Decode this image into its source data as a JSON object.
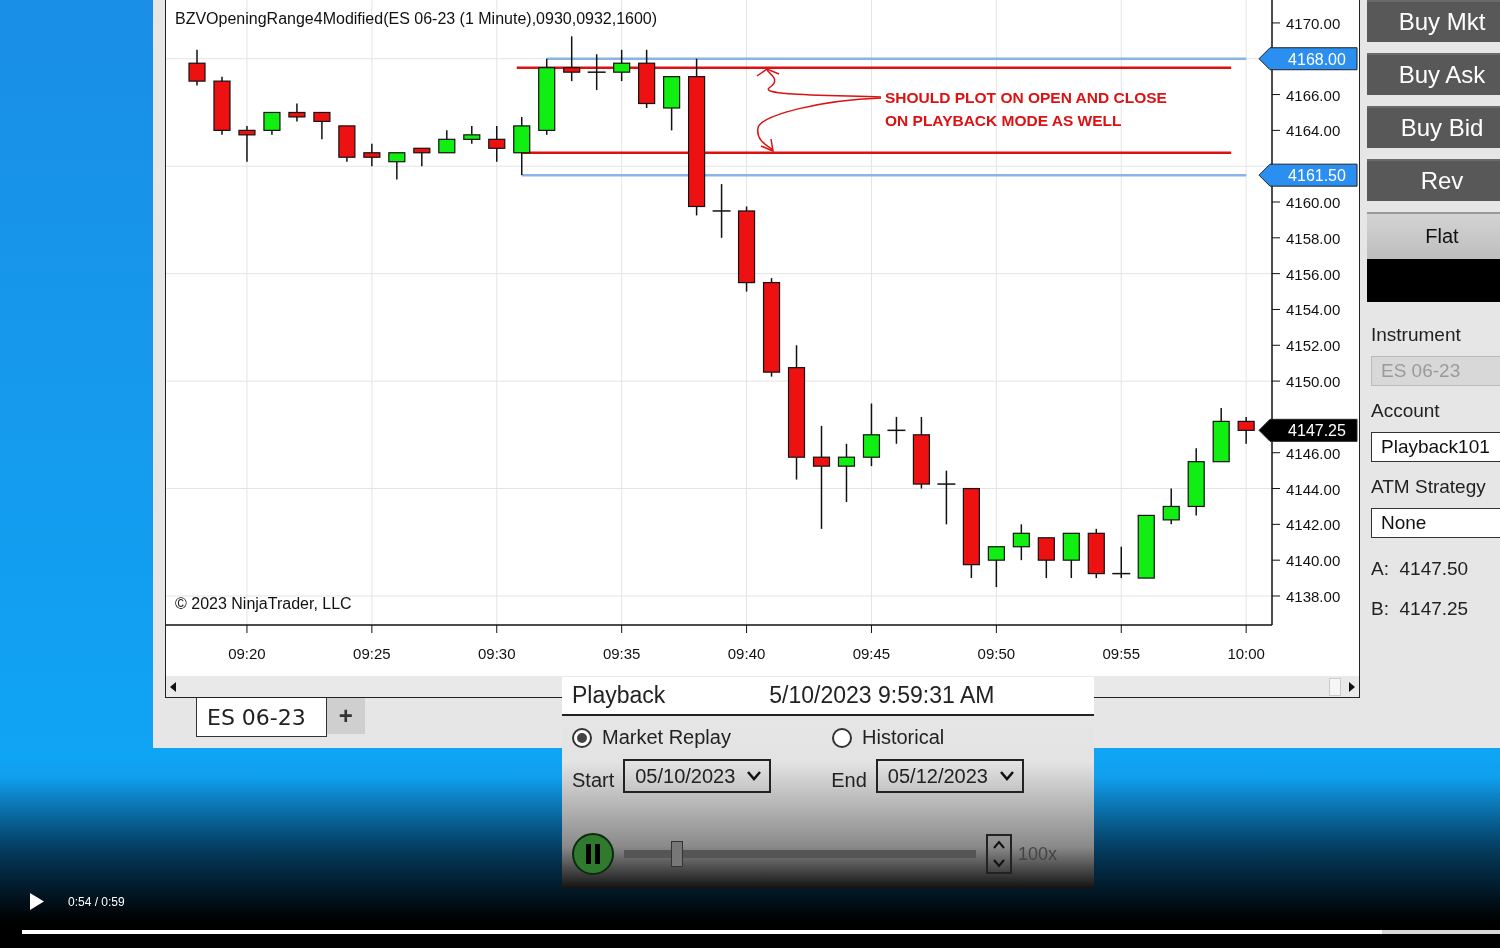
{
  "chart": {
    "title": "BZVOpeningRange4Modified(ES 06-23 (1 Minute),0930,0932,1600)",
    "copyright": "© 2023 NinjaTrader, LLC",
    "chart_data": {
      "type": "candlestick",
      "ylim": [
        4136.38,
        4171.28
      ],
      "grid": true,
      "categories": [
        null,
        null,
        "09:20",
        null,
        null,
        null,
        null,
        "09:25",
        null,
        null,
        null,
        null,
        "09:30",
        null,
        null,
        null,
        null,
        "09:35",
        null,
        null,
        null,
        null,
        "09:40",
        null,
        null,
        null,
        null,
        "09:45",
        null,
        null,
        null,
        null,
        "09:50",
        null,
        null,
        null,
        null,
        "09:55",
        null,
        null,
        null,
        null,
        "10:00"
      ],
      "ohlc": [
        [
          4167.75,
          4168.5,
          4166.5,
          4166.75
        ],
        [
          4166.75,
          4167,
          4163.75,
          4164
        ],
        [
          4164,
          4164.25,
          4162.25,
          4163.75
        ],
        [
          4164,
          4165,
          4163.75,
          4165
        ],
        [
          4165,
          4165.5,
          4164.5,
          4164.75
        ],
        [
          4165,
          4165,
          4163.5,
          4164.5
        ],
        [
          4164.25,
          4164.25,
          4162.25,
          4162.5
        ],
        [
          4162.75,
          4163.25,
          4162,
          4162.5
        ],
        [
          4162.25,
          4162.75,
          4161.25,
          4162.75
        ],
        [
          4163,
          4163,
          4162,
          4162.75
        ],
        [
          4162.75,
          4164,
          4162.75,
          4163.5
        ],
        [
          4163.5,
          4164.25,
          4163.25,
          4163.75
        ],
        [
          4163.5,
          4164.25,
          4162.25,
          4163
        ],
        [
          4162.75,
          4164.75,
          4161.5,
          4164.25
        ],
        [
          4164,
          4168,
          4163.75,
          4167.5
        ],
        [
          4167.5,
          4169.25,
          4166.75,
          4167.25
        ],
        [
          4167.25,
          4168.25,
          4166.25,
          4167.25
        ],
        [
          4167.25,
          4168.5,
          4166.75,
          4167.75
        ],
        [
          4167.75,
          4168.5,
          4165.25,
          4165.5
        ],
        [
          4165.25,
          4167,
          4164,
          4167
        ],
        [
          4167,
          4168,
          4159.25,
          4159.75
        ],
        [
          4159.5,
          4161,
          4158,
          4159.5
        ],
        [
          4159.5,
          4159.75,
          4155,
          4155.5
        ],
        [
          4155.5,
          4155.75,
          4150.25,
          4150.5
        ],
        [
          4150.75,
          4152,
          4144.5,
          4145.75
        ],
        [
          4145.75,
          4147.5,
          4141.75,
          4145.25
        ],
        [
          4145.25,
          4146.5,
          4143.25,
          4145.75
        ],
        [
          4145.75,
          4148.75,
          4145.25,
          4147
        ],
        [
          4147.25,
          4148,
          4146.5,
          4147.25
        ],
        [
          4147,
          4148,
          4144,
          4144.25
        ],
        [
          4144.25,
          4145,
          4142,
          4144.25
        ],
        [
          4144,
          4144,
          4139,
          4139.75
        ],
        [
          4140,
          4140.75,
          4138.5,
          4140.75
        ],
        [
          4140.75,
          4142,
          4140,
          4141.5
        ],
        [
          4141.25,
          4141.25,
          4139,
          4140
        ],
        [
          4140,
          4141.5,
          4139,
          4141.5
        ],
        [
          4141.5,
          4141.75,
          4139,
          4139.25
        ],
        [
          4139.25,
          4140.75,
          4139,
          4139.25
        ],
        [
          4139,
          4142.5,
          4139,
          4142.5
        ],
        [
          4142.25,
          4144,
          4142,
          4143
        ],
        [
          4143,
          4146.25,
          4142.5,
          4145.5
        ],
        [
          4145.5,
          4148.5,
          4145.5,
          4147.75
        ],
        [
          4147.75,
          4148,
          4146.5,
          4147.25
        ]
      ],
      "yticks": [
        {
          "value": 4170,
          "label": "4170.00"
        },
        {
          "value": 4166,
          "label": "4166.00"
        },
        {
          "value": 4164,
          "label": "4164.00"
        },
        {
          "value": 4160,
          "label": "4160.00"
        },
        {
          "value": 4158,
          "label": "4158.00"
        },
        {
          "value": 4156,
          "label": "4156.00"
        },
        {
          "value": 4154,
          "label": "4154.00"
        },
        {
          "value": 4152,
          "label": "4152.00"
        },
        {
          "value": 4150,
          "label": "4150.00"
        },
        {
          "value": 4146,
          "label": "4146.00"
        },
        {
          "value": 4144,
          "label": "4144.00"
        },
        {
          "value": 4142,
          "label": "4142.00"
        },
        {
          "value": 4140,
          "label": "4140.00"
        },
        {
          "value": 4138,
          "label": "4138.00"
        }
      ],
      "ref_lines": [
        {
          "axis": "y",
          "value": 4168,
          "color": "#8ab4e6",
          "label": "4168.00"
        },
        {
          "axis": "y",
          "value": 4161.5,
          "color": "#8ab4e6",
          "label": "4161.50"
        },
        {
          "axis": "y",
          "value": 4167.5,
          "color": "#dd1111"
        },
        {
          "axis": "y",
          "value": 4162.75,
          "color": "#dd1111"
        }
      ]
    },
    "last_price": "4147.25",
    "annotation": [
      "SHOULD PLOT ON OPEN AND CLOSE",
      "ON PLAYBACK MODE AS WELL"
    ]
  },
  "tabs": [
    {
      "label": "ES 06-23",
      "selected": true
    }
  ],
  "add_tab": "+",
  "order_buttons": [
    {
      "label": "Buy Mkt",
      "kind": "dark"
    },
    {
      "label": "Buy Ask",
      "kind": "dark"
    },
    {
      "label": "Buy Bid",
      "kind": "dark"
    },
    {
      "label": "Rev",
      "kind": "dark"
    },
    {
      "label": "Flat",
      "kind": "light"
    }
  ],
  "fields": [
    {
      "label": "Instrument",
      "value": "ES 06-23",
      "disabled": true
    },
    {
      "label": "Account",
      "value": "Playback101",
      "disabled": false
    },
    {
      "label": "ATM Strategy",
      "value": "None",
      "disabled": false
    }
  ],
  "quotes": [
    {
      "label": "A:",
      "value": "4147.50"
    },
    {
      "label": "B:",
      "value": "4147.25"
    }
  ],
  "playback": {
    "title": "Playback",
    "time": "5/10/2023 9:59:31 AM",
    "modes": [
      {
        "label": "Market Replay",
        "selected": true
      },
      {
        "label": "Historical",
        "selected": false
      }
    ],
    "start": {
      "label": "Start",
      "value": "05/10/2023"
    },
    "end": {
      "label": "End",
      "value": "05/12/2023"
    },
    "playing": true,
    "level": 0.15,
    "speed": "100x"
  },
  "video": {
    "time": "0:54 / 0:59",
    "level": 0.92
  }
}
